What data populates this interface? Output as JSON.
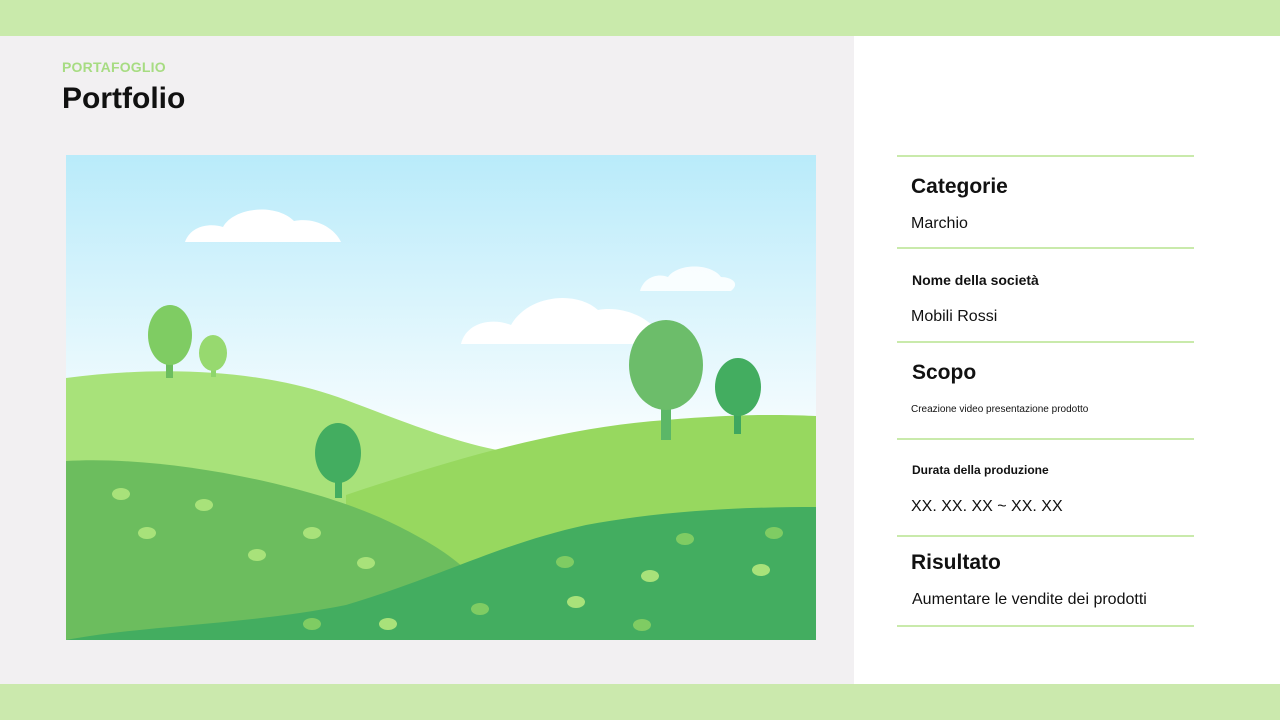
{
  "header": {
    "eyebrow": "PORTAFOGLIO",
    "title": "Portfolio"
  },
  "colors": {
    "accent": "#c9eaab",
    "eyebrow": "#a7dc82",
    "left_panel_bg": "#f2f0f2",
    "sky_top": "#b9ebfa",
    "hill_light": "#a8e27a",
    "hill_dark": "#43ad60"
  },
  "hero_image": {
    "icon": "landscape-illustration"
  },
  "details": {
    "category": {
      "label": "Categorie",
      "value": "Marchio"
    },
    "company": {
      "label": "Nome della società",
      "value": "Mobili Rossi"
    },
    "scope": {
      "label": "Scopo",
      "value": "Creazione video presentazione prodotto"
    },
    "duration": {
      "label": "Durata della produzione",
      "value": "XX. XX. XX ~ XX. XX"
    },
    "result": {
      "label": "Risultato",
      "value": "Aumentare le vendite dei prodotti"
    }
  }
}
